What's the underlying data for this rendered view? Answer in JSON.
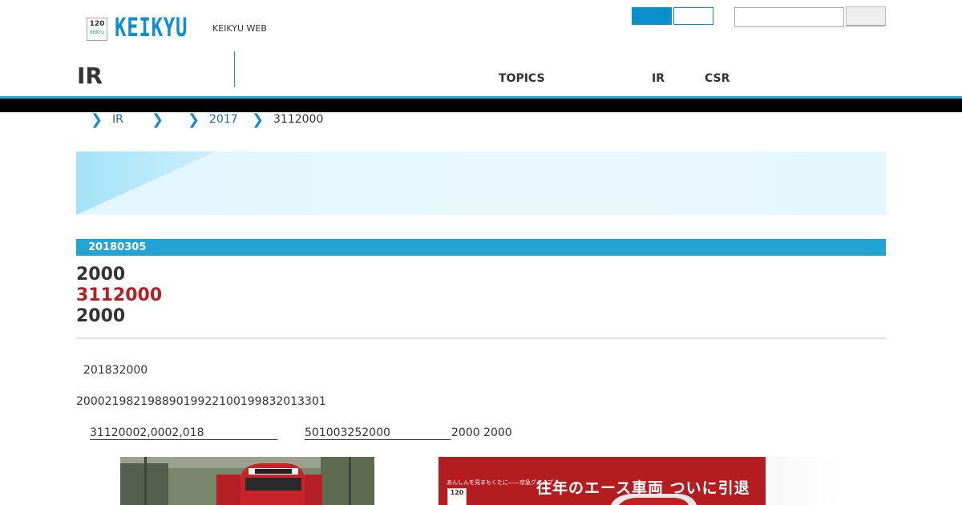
{
  "header": {
    "logo_badge_number": "120",
    "logo_badge_brand": "KEIKYU",
    "logo_text": "KEIKYU",
    "site_link": "KEIKYU WEB"
  },
  "section": {
    "title": "IR",
    "nav": [
      "TOPICS",
      "IR",
      "CSR"
    ]
  },
  "breadcrumb": {
    "items": [
      "IR",
      "",
      "2017",
      "3112000"
    ]
  },
  "colors": {
    "accent": "#0a8ecd",
    "date_bar": "#21a3d3",
    "highlight_red": "#b61f24",
    "banner_light": "#e5f6fd",
    "banner_triangle": "#a9e4f8",
    "header_bar": "#000000",
    "poster_red": "#b41d1f"
  },
  "article": {
    "date": "20180305",
    "headline": [
      "2000",
      "3112000",
      "2000"
    ],
    "para1": "201832000",
    "para2": "20002198219889019922100199832013301",
    "link1": "31120002,0002,018",
    "link2": "501003252000",
    "tail_text": "2000 2000"
  },
  "poster": {
    "small_text": "あんしんを見まもくたに――京急グループ",
    "badge": "120",
    "title": "往年のエース車両 ついに引退"
  },
  "icons": {
    "breadcrumb_separator": "chevron-right-icon"
  }
}
